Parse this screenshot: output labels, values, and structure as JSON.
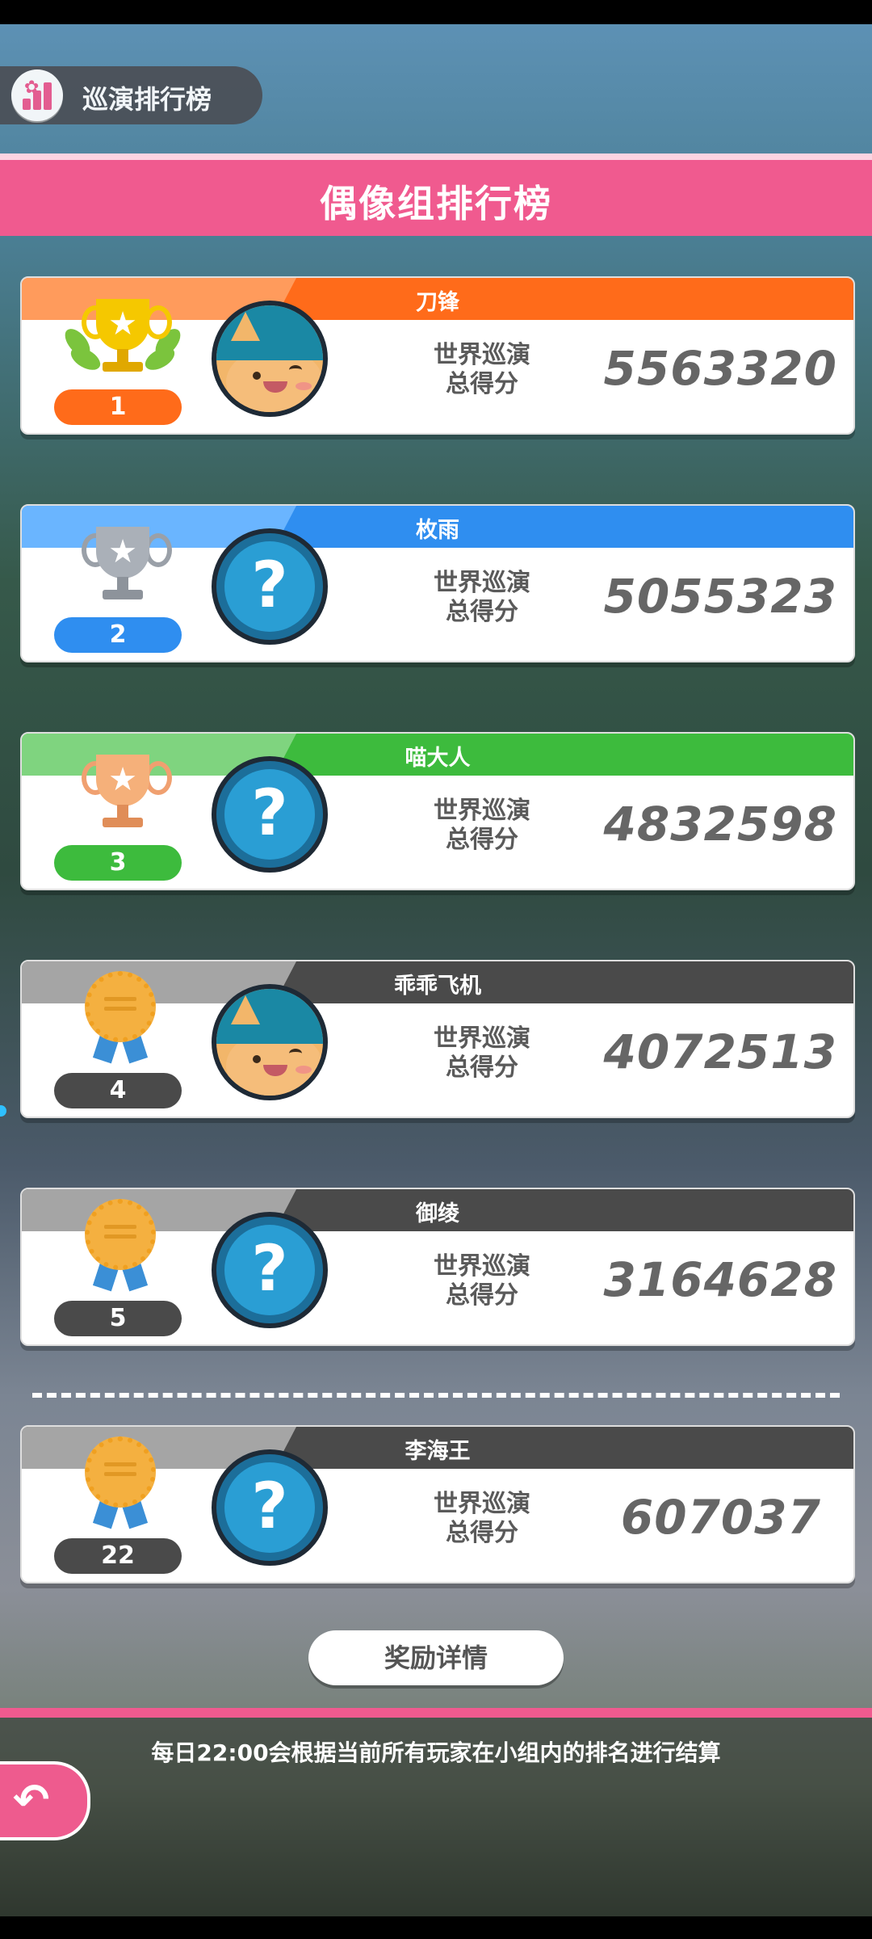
{
  "header": {
    "tour_ranking_label": "巡演排行榜",
    "title": "偶像组排行榜"
  },
  "score_label_line1": "世界巡演",
  "score_label_line2": "总得分",
  "entries": [
    {
      "rank": "1",
      "name": "刀锋",
      "score": "5563320",
      "avatar": "cat-icon",
      "trophy": "gold-trophy-icon"
    },
    {
      "rank": "2",
      "name": "枚雨",
      "score": "5055323",
      "avatar": "question-mark-icon",
      "trophy": "silver-trophy-icon"
    },
    {
      "rank": "3",
      "name": "喵大人",
      "score": "4832598",
      "avatar": "question-mark-icon",
      "trophy": "bronze-trophy-icon"
    },
    {
      "rank": "4",
      "name": "乖乖飞机",
      "score": "4072513",
      "avatar": "cat-icon",
      "trophy": "medal-icon"
    },
    {
      "rank": "5",
      "name": "御绫",
      "score": "3164628",
      "avatar": "question-mark-icon",
      "trophy": "medal-icon"
    },
    {
      "rank": "22",
      "name": "李海王",
      "score": "607037",
      "avatar": "question-mark-icon",
      "trophy": "medal-icon"
    }
  ],
  "reward_button": "奖励详情",
  "notice": "每日22:00会根据当前所有玩家在小组内的排名进行结算",
  "colors": {
    "pink": "#f05a8f",
    "gold": "#ff6b1a",
    "silver": "#2f8ef0",
    "bronze": "#3dbb3d",
    "other": "#4a4a4a"
  }
}
